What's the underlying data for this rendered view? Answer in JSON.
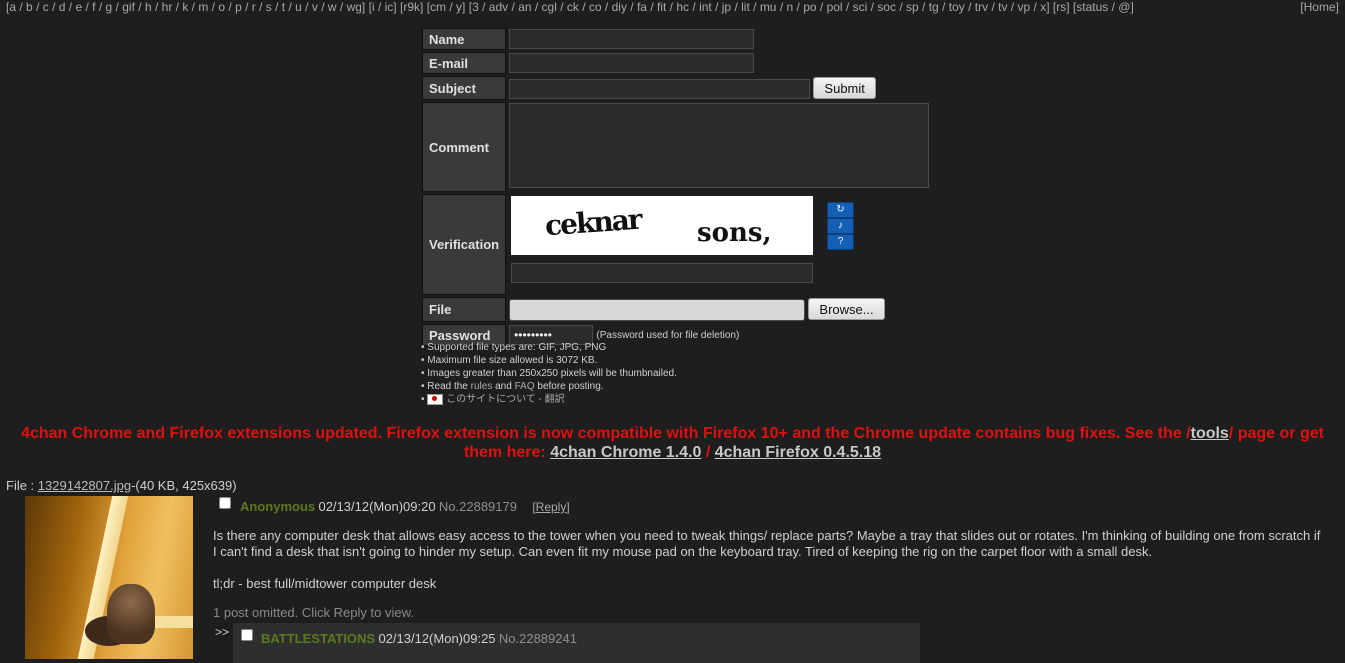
{
  "nav": {
    "group1": [
      "a",
      "b",
      "c",
      "d",
      "e",
      "f",
      "g",
      "gif",
      "h",
      "hr",
      "k",
      "m",
      "o",
      "p",
      "r",
      "s",
      "t",
      "u",
      "v",
      "w",
      "wg"
    ],
    "group2": [
      "i",
      "ic"
    ],
    "group3": [
      "r9k"
    ],
    "group4": [
      "cm",
      "y"
    ],
    "group5": [
      "3",
      "adv",
      "an",
      "cgl",
      "ck",
      "co",
      "diy",
      "fa",
      "fit",
      "hc",
      "int",
      "jp",
      "lit",
      "mu",
      "n",
      "po",
      "pol",
      "sci",
      "soc",
      "sp",
      "tg",
      "toy",
      "trv",
      "tv",
      "vp",
      "x"
    ],
    "group6": [
      "rs"
    ],
    "group7": [
      "status",
      "@"
    ],
    "home": "Home"
  },
  "form": {
    "name_label": "Name",
    "email_label": "E-mail",
    "subject_label": "Subject",
    "submit": "Submit",
    "comment_label": "Comment",
    "verification_label": "Verification",
    "captcha_word1": "ceknar",
    "captcha_word2": "sons,",
    "file_label": "File",
    "browse": "Browse...",
    "password_label": "Password",
    "password_value": "•••••••••",
    "password_note": "(Password used for file deletion)"
  },
  "rules": {
    "line1": "• Supported file types are: GIF, JPG, PNG",
    "line2": "• Maximum file size allowed is 3072 KB.",
    "line3": "• Images greater than 250x250 pixels will be thumbnailed.",
    "line4_pre": "• Read the ",
    "rules_link": "rules",
    "line4_mid": " and ",
    "faq_link": "FAQ",
    "line4_post": " before posting.",
    "line5_bullet": "•",
    "line5_text": "このサイトについて - 翻訳"
  },
  "announcement": {
    "text1": "4chan Chrome and Firefox extensions updated. Firefox extension is now compatible with Firefox 10+ and the Chrome update contains bug fixes. See the /",
    "tools": "tools",
    "text2": "/ page or get them here: ",
    "chrome": "4chan Chrome 1.4.0",
    "slash": " / ",
    "firefox": "4chan Firefox 0.4.5.18"
  },
  "op": {
    "file_prefix": "File : ",
    "filename": "1329142807.jpg",
    "filemeta": "-(40 KB, 425x639)",
    "name": "Anonymous",
    "datetime": "02/13/12(Mon)09:20",
    "number": "No.22889179",
    "reply_open": "[",
    "reply": "Reply",
    "reply_close": "]",
    "body1": "Is there any computer desk that allows easy access to the tower when you need to tweak things/ replace parts? Maybe a tray that slides out or rotates. I'm thinking of building one from scratch if I can't find a desk that isn't going to hinder my setup. Can even fit my mouse pad on the keyboard tray. Tired of keeping the rig on the carpet floor with a small desk.",
    "body2": "tl;dr - best full/midtower computer desk",
    "omitted": "1 post omitted. Click Reply to view."
  },
  "reply": {
    "arrows": ">>",
    "name": "BATTLESTATIONS",
    "datetime": "02/13/12(Mon)09:25",
    "number": "No.22889241"
  }
}
